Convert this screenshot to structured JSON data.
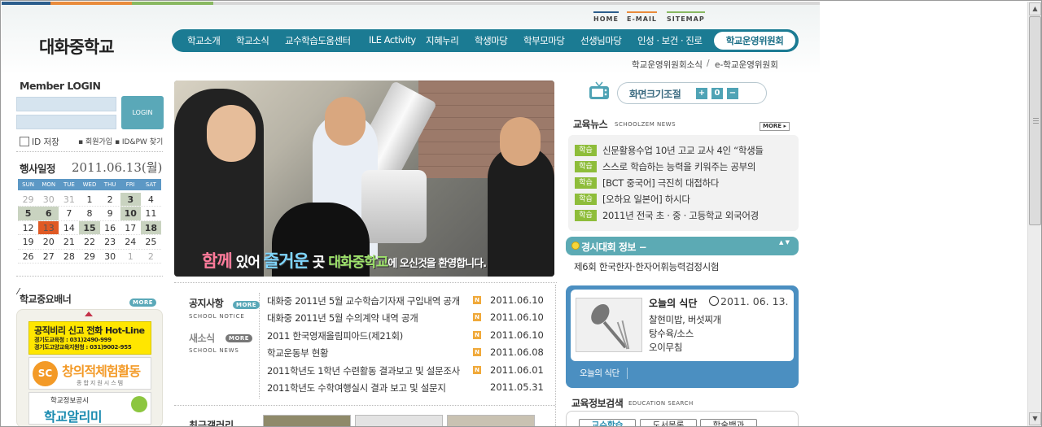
{
  "header": {
    "school_name": "대화중학교",
    "util_menu": [
      "HOME",
      "E-MAIL",
      "SITEMAP"
    ],
    "nav": [
      "학교소개",
      "학교소식",
      "교수학습도움센터",
      "ILE Activity",
      "지혜누리",
      "학생마당",
      "학부모마당",
      "선생님마당",
      "인성 · 보건 · 진로"
    ],
    "nav_active": "학교운영위원회",
    "sub_menu": [
      "학교운영위원회소식",
      "e-학교운영위원회"
    ],
    "sub_separator": "/"
  },
  "login": {
    "title": "Member LOGIN",
    "button": "LOGIN",
    "id_save": "ID 저장",
    "links": "▪ 회원가입 ▪ ID&PW 찾기"
  },
  "calendar": {
    "title": "행사일정",
    "date": "2011.06.13(월)",
    "weekdays": [
      "SUN",
      "MON",
      "TUE",
      "WED",
      "THU",
      "FRI",
      "SAT"
    ],
    "weeks": [
      [
        {
          "d": "29",
          "s": "dim"
        },
        {
          "d": "30",
          "s": "dim"
        },
        {
          "d": "31",
          "s": "dim"
        },
        {
          "d": "1"
        },
        {
          "d": "2"
        },
        {
          "d": "3",
          "s": "ev"
        },
        {
          "d": "4"
        }
      ],
      [
        {
          "d": "5",
          "s": "ev"
        },
        {
          "d": "6",
          "s": "ev"
        },
        {
          "d": "7"
        },
        {
          "d": "8"
        },
        {
          "d": "9"
        },
        {
          "d": "10",
          "s": "ev"
        },
        {
          "d": "11"
        }
      ],
      [
        {
          "d": "12"
        },
        {
          "d": "13",
          "s": "today"
        },
        {
          "d": "14"
        },
        {
          "d": "15",
          "s": "ev"
        },
        {
          "d": "16"
        },
        {
          "d": "17"
        },
        {
          "d": "18",
          "s": "ev"
        }
      ],
      [
        {
          "d": "19"
        },
        {
          "d": "20"
        },
        {
          "d": "21"
        },
        {
          "d": "22"
        },
        {
          "d": "23"
        },
        {
          "d": "24"
        },
        {
          "d": "25"
        }
      ],
      [
        {
          "d": "26"
        },
        {
          "d": "27"
        },
        {
          "d": "28"
        },
        {
          "d": "29"
        },
        {
          "d": "30"
        },
        {
          "d": "1",
          "s": "dim"
        },
        {
          "d": "2",
          "s": "dim"
        }
      ]
    ]
  },
  "banners": {
    "title": "학교중요배너",
    "more": "MORE",
    "b1_title": "공직비리 신고 전화 Hot-Line",
    "b1_line1": "경기도교육청 : 031)2490-999",
    "b1_line2": "경기도고양교육지원청 : 031)9002-955",
    "b2_icon": "SC",
    "b2_title": "창의적체험활동",
    "b2_sub": "종합지원시스템",
    "b3_line1": "학교정보공시",
    "b3_title": "학교알리미"
  },
  "visual": {
    "slogan_1": "함께",
    "slogan_2": "있어",
    "slogan_3": "즐거운",
    "slogan_4": "곳",
    "slogan_5": "대화중학교",
    "slogan_6": "에 오신것을 환영합니다."
  },
  "font_size": {
    "label": "화면크기조절",
    "plus": "+",
    "zero": "0",
    "minus": "−"
  },
  "news": {
    "title": "교육뉴스",
    "subtitle": "SCHOOLZEM NEWS",
    "more": "MORE ▸",
    "items": [
      {
        "tag": "학습",
        "text": "신문활용수업 10년 고교 교사 4인 “학생들"
      },
      {
        "tag": "학습",
        "text": "스스로 학습하는 능력을 키워주는 공부의"
      },
      {
        "tag": "학습",
        "text": "[BCT 중국어] 극진히 대접하다"
      },
      {
        "tag": "학습",
        "text": "[오하요 일본어] 하시다"
      },
      {
        "tag": "학습",
        "text": "2011년 전국 초 · 중 · 고등학교 외국어경"
      }
    ]
  },
  "contest": {
    "title": "경시대회 정보 −",
    "arrows": "▲ ▼",
    "text": "제6회 한국한자·한자어휘능력검정시험"
  },
  "meal": {
    "title": "오늘의 식단",
    "date": "2011. 06. 13.",
    "items": [
      "찰현미밥, 버섯찌개",
      "탕수육/소스",
      "오이무침"
    ],
    "tab": "오늘의 식단"
  },
  "edu_search": {
    "title": "교육정보검색",
    "subtitle": "EDUCATION SEARCH",
    "tabs": [
      "교수학습",
      "도서목록",
      "학술백과"
    ]
  },
  "board": {
    "notice_title": "공지사항",
    "notice_sub": "SCHOOL NOTICE",
    "news_title": "새소식",
    "news_sub": "SCHOOL NEWS",
    "more": "MORE",
    "new_badge": "N",
    "rows": [
      {
        "title": "대화중 2011년 5월 교수학습기자재 구입내역 공개",
        "new": true,
        "date": "2011.06.10"
      },
      {
        "title": "대화중 2011년 5월 수의계약 내역 공개",
        "new": true,
        "date": "2011.06.10"
      },
      {
        "title": "2011 한국영재올림피아드(제21회)",
        "new": true,
        "date": "2011.06.10"
      },
      {
        "title": "학교운동부 현황",
        "new": true,
        "date": "2011.06.08"
      },
      {
        "title": "2011학년도 1학년 수련활동 결과보고 및 설문조사",
        "new": true,
        "date": "2011.06.01"
      },
      {
        "title": "2011학년도 수학여행실시 결과 보고 및 설문지",
        "new": false,
        "date": "2011.05.31"
      }
    ],
    "gallery_title": "최근갤러리"
  },
  "colors": {
    "nav_bg": "#1b7b93",
    "accent_teal": "#5aa8b8",
    "meal_blue": "#4b8fc1",
    "tag_green": "#8ebd3a",
    "today_orange": "#e05a24"
  }
}
